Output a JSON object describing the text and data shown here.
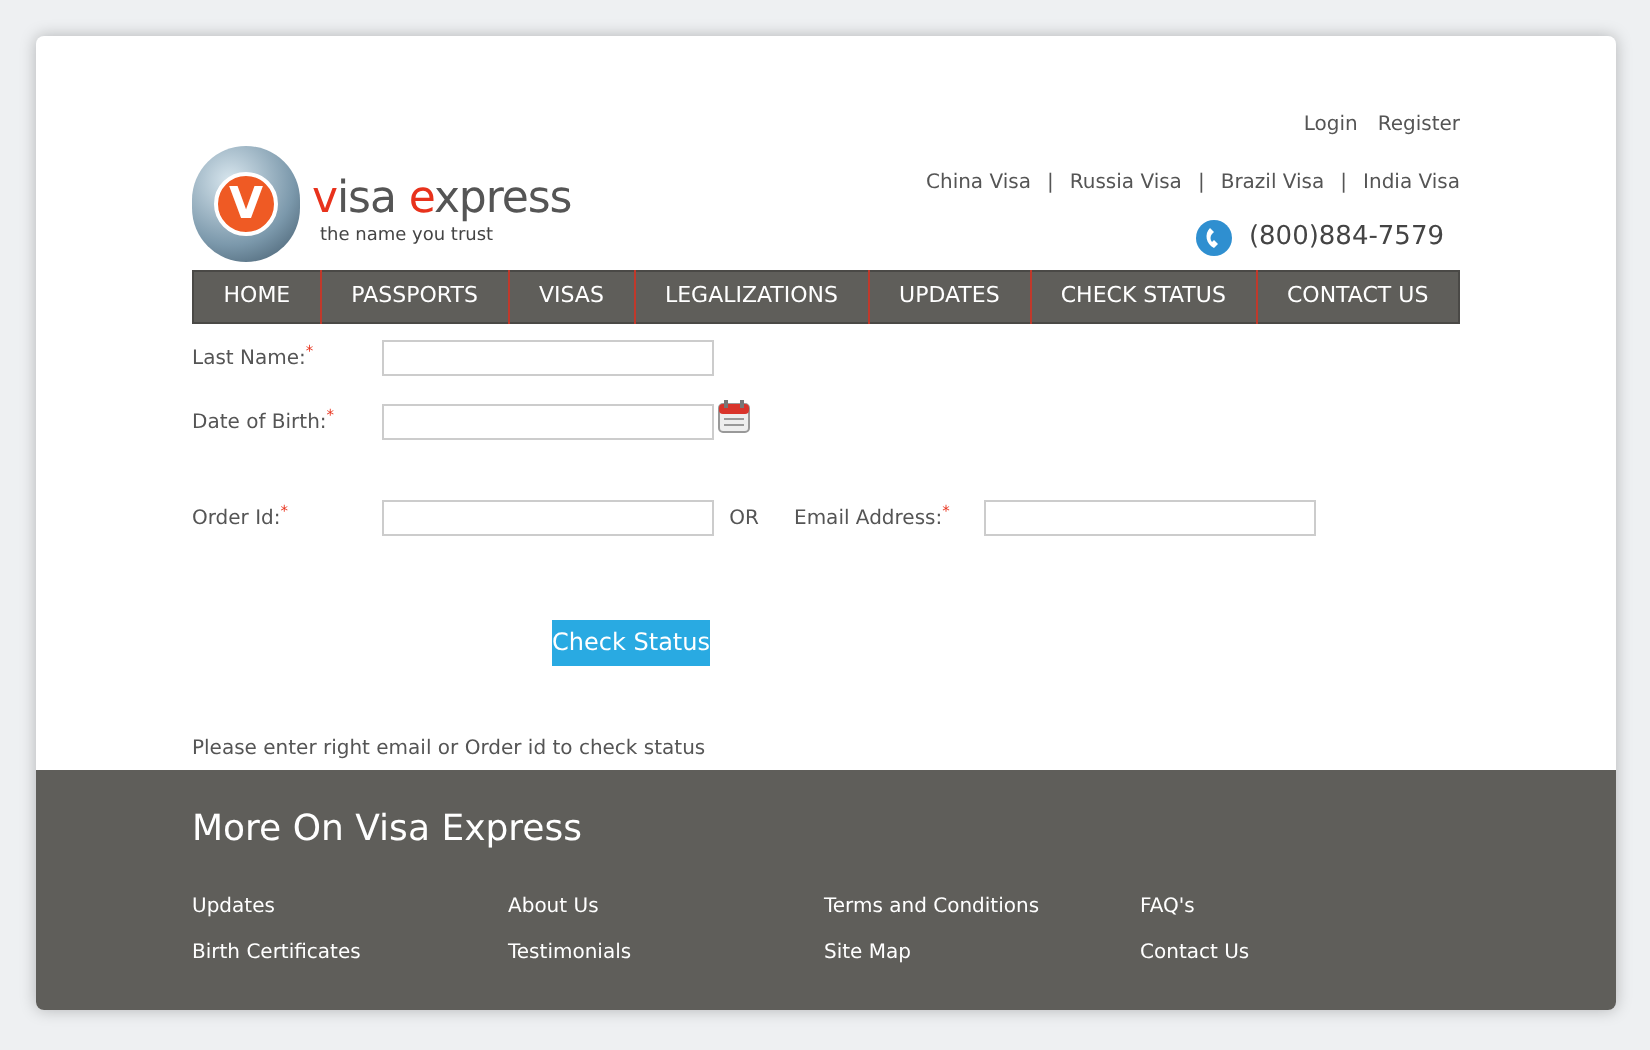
{
  "header": {
    "account_links": [
      "Login",
      "Register"
    ],
    "visa_links": [
      "China Visa",
      "Russia Visa",
      "Brazil Visa",
      "India Visa"
    ],
    "separator": "|",
    "phone": "(800)884-7579"
  },
  "logo": {
    "mark": "V",
    "name_words": [
      "visa",
      "express"
    ],
    "tagline": "the name you trust"
  },
  "nav": [
    "HOME",
    "PASSPORTS",
    "VISAS",
    "LEGALIZATIONS",
    "UPDATES",
    "CHECK STATUS",
    "CONTACT US"
  ],
  "form": {
    "rows": [
      {
        "fields": [
          {
            "label": "Last Name:",
            "required_mark": "*"
          }
        ],
        "calendar": false
      },
      {
        "fields": [
          {
            "label": "Date of Birth:",
            "required_mark": "*"
          }
        ],
        "calendar": true
      },
      {
        "fields": [
          {
            "label": "Order Id:",
            "required_mark": "*"
          },
          {
            "label": "Email Address:",
            "required_mark": "*"
          }
        ],
        "joiner": "OR",
        "calendar": false
      }
    ],
    "submit": "Check Status",
    "note": "Please enter right email or Order id to check status"
  },
  "footer": {
    "title": "More On Visa Express",
    "columns": [
      [
        "Updates",
        "Birth Certificates"
      ],
      [
        "About Us",
        "Testimonials"
      ],
      [
        "Terms and Conditions",
        "Site Map"
      ],
      [
        "FAQ's",
        "Contact Us"
      ]
    ]
  }
}
